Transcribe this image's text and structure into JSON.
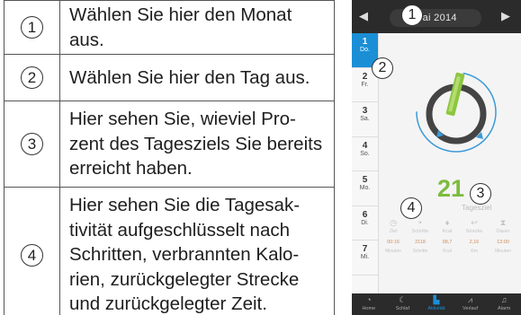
{
  "legend": [
    {
      "num": "1",
      "text": "Wählen Sie hier den Monat aus."
    },
    {
      "num": "2",
      "text": "Wählen Sie hier den Tag aus."
    },
    {
      "num": "3",
      "text": "Hier sehen Sie, wieviel Pro-zent des Tagesziels Sie bereits erreicht haben."
    },
    {
      "num": "4",
      "text": "Hier sehen Sie die Tagesak-tivität aufgeschlüsselt nach Schritten, verbrannten Kalo-rien, zurückgelegter Strecke und zurückgelegter Zeit."
    }
  ],
  "phone": {
    "month": "Mai 2014",
    "prev_icon": "triangle-left-icon",
    "next_icon": "triangle-right-icon",
    "days": [
      {
        "num": "1",
        "wd": "Do."
      },
      {
        "num": "2",
        "wd": "Fr."
      },
      {
        "num": "3",
        "wd": "Sa."
      },
      {
        "num": "4",
        "wd": "So."
      },
      {
        "num": "5",
        "wd": "Mo."
      },
      {
        "num": "6",
        "wd": "Di."
      },
      {
        "num": "7",
        "wd": "Mi."
      }
    ],
    "percent_value": "21",
    "percent_label": "Tagesziel",
    "activity": [
      {
        "label": "Ziel",
        "value": "00:16",
        "unit": "Minuten"
      },
      {
        "label": "Schritte",
        "value": "2118",
        "unit": "Schritte"
      },
      {
        "label": "Kcal",
        "value": "98,7",
        "unit": "Kcal"
      },
      {
        "label": "Strecke",
        "value": "2,16",
        "unit": "Km"
      },
      {
        "label": "Dauer",
        "value": "13:00",
        "unit": "Minuten"
      }
    ],
    "nav": [
      {
        "label": "Home",
        "icon": "gauge-icon"
      },
      {
        "label": "Schlaf",
        "icon": "moon-icon"
      },
      {
        "label": "Aktivität",
        "icon": "shoe-icon"
      },
      {
        "label": "Verlauf",
        "icon": "chart-icon"
      },
      {
        "label": "Alarm",
        "icon": "bell-icon"
      }
    ],
    "callouts": [
      "1",
      "2",
      "3",
      "4"
    ]
  },
  "colors": {
    "accent": "#1b8fd6",
    "green": "#7dbb3e",
    "dark": "#2b2b2b"
  }
}
